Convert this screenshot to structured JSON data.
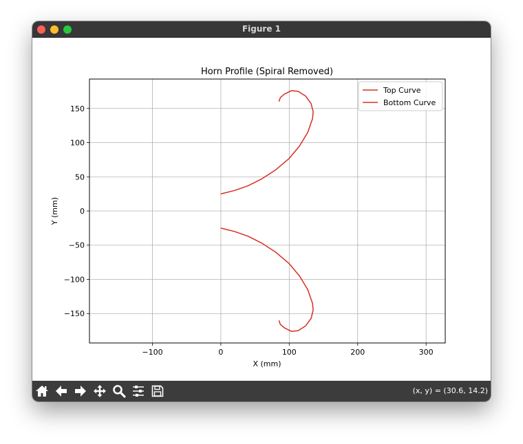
{
  "window": {
    "title": "Figure 1"
  },
  "toolbar": {
    "buttons": [
      {
        "name": "home-button",
        "icon": "home-icon"
      },
      {
        "name": "back-button",
        "icon": "arrow-left-icon"
      },
      {
        "name": "forward-button",
        "icon": "arrow-right-icon"
      },
      {
        "name": "pan-button",
        "icon": "move-icon"
      },
      {
        "name": "zoom-button",
        "icon": "magnifier-icon"
      },
      {
        "name": "configure-subplots-button",
        "icon": "sliders-icon"
      },
      {
        "name": "save-button",
        "icon": "floppy-disk-icon"
      }
    ],
    "coords": "(x, y) = (30.6, 14.2)"
  },
  "chart_data": {
    "type": "line",
    "title": "Horn Profile (Spiral Removed)",
    "xlabel": "X (mm)",
    "ylabel": "Y (mm)",
    "xlim": [
      -192,
      328
    ],
    "ylim": [
      -193,
      193
    ],
    "xticks": [
      -100,
      0,
      100,
      200,
      300
    ],
    "yticks": [
      -150,
      -100,
      -50,
      0,
      50,
      100,
      150
    ],
    "xtick_labels": [
      "−100",
      "0",
      "100",
      "200",
      "300"
    ],
    "ytick_labels": [
      "−150",
      "−100",
      "−50",
      "0",
      "50",
      "100",
      "150"
    ],
    "grid": true,
    "legend_position": "top-right",
    "series": [
      {
        "name": "Top Curve",
        "color": "#d62e1f",
        "points": [
          [
            0,
            25
          ],
          [
            20,
            30
          ],
          [
            40,
            37
          ],
          [
            60,
            47
          ],
          [
            80,
            60
          ],
          [
            100,
            77
          ],
          [
            115,
            95
          ],
          [
            127,
            115
          ],
          [
            134,
            135
          ],
          [
            135,
            145
          ],
          [
            132,
            157
          ],
          [
            124,
            168
          ],
          [
            113,
            175
          ],
          [
            103,
            176
          ],
          [
            93,
            171
          ],
          [
            87,
            166
          ],
          [
            85,
            160
          ]
        ]
      },
      {
        "name": "Bottom Curve",
        "color": "#d62e1f",
        "points": [
          [
            0,
            -25
          ],
          [
            20,
            -30
          ],
          [
            40,
            -37
          ],
          [
            60,
            -47
          ],
          [
            80,
            -60
          ],
          [
            100,
            -77
          ],
          [
            115,
            -95
          ],
          [
            127,
            -115
          ],
          [
            134,
            -135
          ],
          [
            135,
            -145
          ],
          [
            132,
            -157
          ],
          [
            124,
            -168
          ],
          [
            113,
            -175
          ],
          [
            103,
            -176
          ],
          [
            93,
            -171
          ],
          [
            87,
            -166
          ],
          [
            85,
            -160
          ]
        ]
      }
    ]
  }
}
